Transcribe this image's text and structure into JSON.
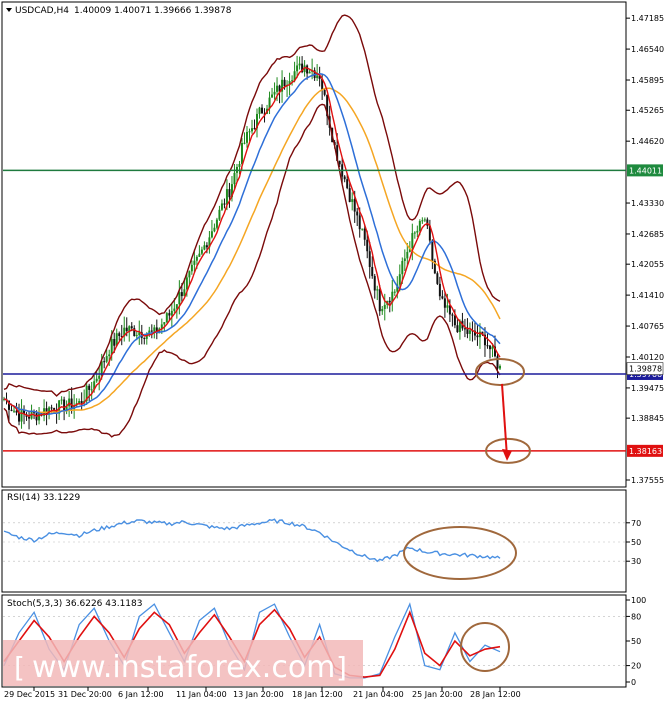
{
  "header": {
    "symbol": "USDCAD,H4",
    "ohlc": "1.40009 1.40071 1.39666 1.39878"
  },
  "colors": {
    "up_candle": "#1e8a1e",
    "down_candle": "#111111",
    "ma_fast": "#e01010",
    "ma_slow": "#2e6fd8",
    "ma_long": "#f5a623",
    "bollinger": "#7a0a0a",
    "resistance_line": "#1e7a3e",
    "support_line": "#1c1c9c",
    "target_line": "#e01010",
    "annotation_circle": "#a0683c",
    "arrow": "#e01010",
    "rsi_line": "#4a90e2",
    "stoch_main": "#4a90e2",
    "stoch_signal": "#e01010",
    "label_green_bg": "#1e8a3e",
    "label_blue_bg": "#1c1c9c",
    "label_red_bg": "#e01010",
    "watermark_bg": "#f2b8b8"
  },
  "chart_data": [
    {
      "type": "candlestick",
      "title": "USDCAD,H4",
      "y_ticks": [
        "1.47185",
        "1.46540",
        "1.45895",
        "1.45265",
        "1.44620",
        "1.43330",
        "1.42685",
        "1.42055",
        "1.41410",
        "1.40765",
        "1.40120",
        "1.39475",
        "1.38845",
        "1.37555"
      ],
      "ylim": [
        1.3743,
        1.4748
      ],
      "x_ticks": [
        "29 Dec 2015",
        "31 Dec 20:00",
        "6 Jan 12:00",
        "11 Jan 04:00",
        "13 Jan 20:00",
        "18 Jan 12:00",
        "21 Jan 04:00",
        "25 Jan 20:00",
        "28 Jan 12:00"
      ],
      "close_path": [
        [
          0,
          1.3925
        ],
        [
          6,
          1.389
        ],
        [
          12,
          1.389
        ],
        [
          18,
          1.3905
        ],
        [
          24,
          1.391
        ],
        [
          30,
          1.3915
        ],
        [
          36,
          1.396
        ],
        [
          42,
          1.403
        ],
        [
          48,
          1.407
        ],
        [
          54,
          1.4065
        ],
        [
          60,
          1.406
        ],
        [
          66,
          1.41
        ],
        [
          72,
          1.416
        ],
        [
          78,
          1.422
        ],
        [
          84,
          1.429
        ],
        [
          90,
          1.436
        ],
        [
          96,
          1.446
        ],
        [
          102,
          1.452
        ],
        [
          108,
          1.456
        ],
        [
          114,
          1.46
        ],
        [
          120,
          1.462
        ],
        [
          126,
          1.46
        ],
        [
          132,
          1.445
        ],
        [
          138,
          1.435
        ],
        [
          144,
          1.425
        ],
        [
          150,
          1.412
        ],
        [
          156,
          1.415
        ],
        [
          162,
          1.425
        ],
        [
          168,
          1.43
        ],
        [
          174,
          1.413
        ],
        [
          180,
          1.408
        ],
        [
          186,
          1.406
        ],
        [
          192,
          1.405
        ],
        [
          198,
          1.3988
        ]
      ],
      "lines": [
        {
          "value": 1.44011,
          "label": "1.44011"
        },
        {
          "value": 1.39766,
          "label": "1.39766"
        },
        {
          "value": 1.38163,
          "label": "1.38163"
        },
        {
          "value": 1.39878,
          "label": "1.39878"
        }
      ]
    },
    {
      "type": "line",
      "title": "RSI(14) 33.1229",
      "y_ticks": [
        "70",
        "50",
        "30"
      ],
      "ylim": [
        0,
        100
      ],
      "series": [
        {
          "name": "RSI(14)",
          "values": [
            60,
            55,
            52,
            58,
            60,
            57,
            62,
            66,
            70,
            72,
            70,
            69,
            71,
            68,
            65,
            64,
            67,
            70,
            72,
            70,
            66,
            60,
            50,
            42,
            35,
            30,
            36,
            44,
            40,
            38,
            37,
            36,
            35,
            33
          ]
        }
      ]
    },
    {
      "type": "line",
      "title": "Stoch(5,3,3) 36.6226 43.1183",
      "y_ticks": [
        "100",
        "80",
        "50",
        "20",
        "0"
      ],
      "ylim": [
        0,
        100
      ],
      "series": [
        {
          "name": "Stoch main",
          "values": [
            20,
            60,
            85,
            40,
            15,
            70,
            90,
            50,
            20,
            80,
            95,
            60,
            25,
            75,
            90,
            45,
            15,
            85,
            95,
            55,
            20,
            70,
            10,
            5,
            5,
            10,
            55,
            95,
            20,
            15,
            60,
            25,
            45,
            37
          ]
        },
        {
          "name": "Stoch signal",
          "values": [
            25,
            50,
            75,
            55,
            25,
            55,
            80,
            60,
            30,
            65,
            85,
            70,
            35,
            60,
            82,
            55,
            25,
            70,
            88,
            65,
            30,
            55,
            18,
            8,
            6,
            8,
            40,
            85,
            35,
            20,
            50,
            32,
            40,
            43
          ]
        }
      ]
    }
  ],
  "watermark": {
    "text": "www.instaforex.com"
  }
}
